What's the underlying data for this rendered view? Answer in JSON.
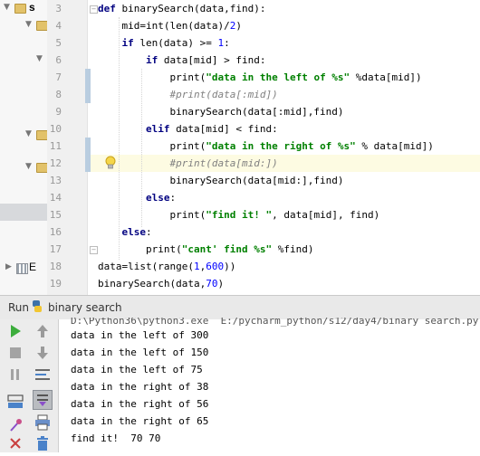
{
  "project_tree": {
    "item_top": "s",
    "item_bottom": "E"
  },
  "editor": {
    "line_numbers": [
      "3",
      "4",
      "5",
      "6",
      "7",
      "8",
      "9",
      "10",
      "11",
      "12",
      "13",
      "14",
      "15",
      "16",
      "17",
      "18",
      "19"
    ],
    "lines": [
      {
        "indent": "",
        "parts": [
          {
            "t": "kw",
            "v": "def "
          },
          {
            "t": "",
            "v": "binarySearch(data,find):"
          }
        ]
      },
      {
        "indent": "    ",
        "parts": [
          {
            "t": "",
            "v": "mid=int(len(data)/"
          },
          {
            "t": "num",
            "v": "2"
          },
          {
            "t": "",
            "v": ")"
          }
        ]
      },
      {
        "indent": "    ",
        "parts": [
          {
            "t": "kw",
            "v": "if "
          },
          {
            "t": "",
            "v": "len(data) >= "
          },
          {
            "t": "num",
            "v": "1"
          },
          {
            "t": "",
            "v": ":"
          }
        ]
      },
      {
        "indent": "        ",
        "parts": [
          {
            "t": "kw",
            "v": "if "
          },
          {
            "t": "",
            "v": "data[mid] > find:"
          }
        ]
      },
      {
        "indent": "            ",
        "parts": [
          {
            "t": "",
            "v": "print("
          },
          {
            "t": "str",
            "v": "\"data in the left of %s\""
          },
          {
            "t": "",
            "v": " %data[mid])"
          }
        ]
      },
      {
        "indent": "            ",
        "parts": [
          {
            "t": "cmt",
            "v": "#print(data[:mid])"
          }
        ]
      },
      {
        "indent": "            ",
        "parts": [
          {
            "t": "",
            "v": "binarySearch(data[:mid],find)"
          }
        ]
      },
      {
        "indent": "        ",
        "parts": [
          {
            "t": "kw",
            "v": "elif "
          },
          {
            "t": "",
            "v": "data[mid] < find:"
          }
        ]
      },
      {
        "indent": "            ",
        "parts": [
          {
            "t": "",
            "v": "print("
          },
          {
            "t": "str",
            "v": "\"data in the right of %s\""
          },
          {
            "t": "",
            "v": " % data[mid])"
          }
        ]
      },
      {
        "indent": "            ",
        "parts": [
          {
            "t": "cmt",
            "v": "#print(data[mid:])"
          }
        ]
      },
      {
        "indent": "            ",
        "parts": [
          {
            "t": "",
            "v": "binarySearch(data[mid:],find)"
          }
        ]
      },
      {
        "indent": "        ",
        "parts": [
          {
            "t": "kw",
            "v": "else"
          },
          {
            "t": "",
            "v": ":"
          }
        ]
      },
      {
        "indent": "            ",
        "parts": [
          {
            "t": "",
            "v": "print("
          },
          {
            "t": "str",
            "v": "\"find it! \""
          },
          {
            "t": "",
            "v": ", data[mid], find)"
          }
        ]
      },
      {
        "indent": "    ",
        "parts": [
          {
            "t": "kw",
            "v": "else"
          },
          {
            "t": "",
            "v": ":"
          }
        ]
      },
      {
        "indent": "        ",
        "parts": [
          {
            "t": "",
            "v": "print("
          },
          {
            "t": "str",
            "v": "\"cant' find %s\""
          },
          {
            "t": "",
            "v": " %find)"
          }
        ]
      },
      {
        "indent": "",
        "parts": [
          {
            "t": "",
            "v": "data=list(range("
          },
          {
            "t": "num",
            "v": "1"
          },
          {
            "t": "",
            "v": ","
          },
          {
            "t": "num",
            "v": "600"
          },
          {
            "t": "",
            "v": "))"
          }
        ]
      },
      {
        "indent": "",
        "parts": [
          {
            "t": "",
            "v": "binarySearch(data,"
          },
          {
            "t": "num",
            "v": "70"
          },
          {
            "t": "",
            "v": ")"
          }
        ]
      }
    ]
  },
  "run_panel": {
    "tab_label": "Run",
    "config_name": "binary search",
    "command_line": "D:\\Python36\\python3.exe  E:/pycharm_python/s12/day4/binary search.py",
    "output": [
      "data in the left of 300",
      "data in the left of 150",
      "data in the left of 75",
      "data in the right of 38",
      "data in the right of 56",
      "data in the right of 65",
      "find it!  70 70"
    ]
  },
  "colors": {
    "keyword": "#000080",
    "string": "#008000",
    "number": "#0000ff",
    "comment": "#808080",
    "caret_line": "#fdfbe2",
    "run_green": "#3cad3c"
  }
}
